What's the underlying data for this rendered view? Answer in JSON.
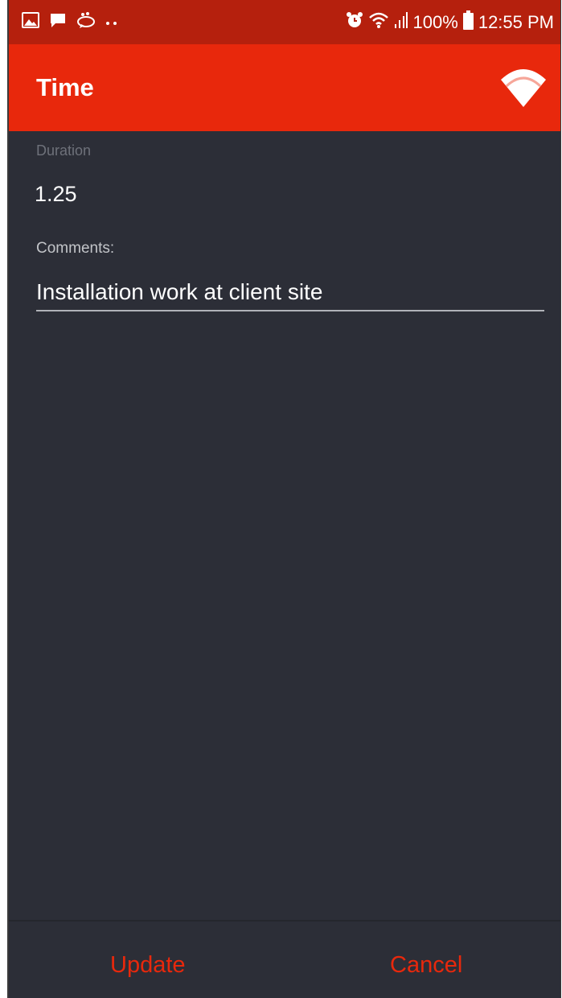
{
  "status_bar": {
    "left_icons": [
      "gallery-icon",
      "message-icon",
      "chat-bubbles-icon",
      "more-dots-icon"
    ],
    "right_icons": [
      "alarm-icon",
      "wifi-icon",
      "signal-icon",
      "battery-icon"
    ],
    "battery": "100%",
    "time": "12:55 PM"
  },
  "app_bar": {
    "title": "Time",
    "action_icon": "wifi-connection-icon",
    "colors": {
      "accent": "#e8280c",
      "status_bar": "#b5200d"
    }
  },
  "form": {
    "duration_label": "Duration",
    "duration_value": "1.25",
    "comments_label": "Comments:",
    "comments_value": "Installation work at client site"
  },
  "actions": {
    "update_label": "Update",
    "cancel_label": "Cancel"
  },
  "colors": {
    "background": "#2c2e37",
    "button_text": "#e8280c"
  }
}
